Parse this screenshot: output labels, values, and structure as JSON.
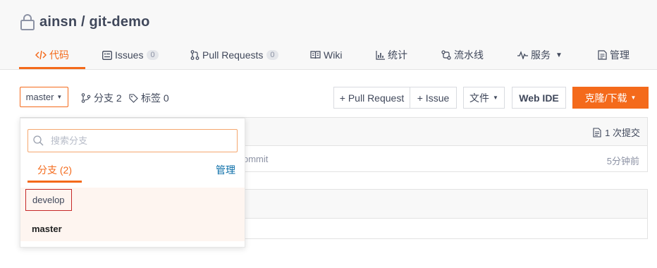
{
  "repo": {
    "title": "ainsn / git-demo",
    "icon": "lock-icon"
  },
  "tabs": [
    {
      "label": "代码",
      "icon": "code-icon",
      "active": true
    },
    {
      "label": "Issues",
      "count": "0",
      "icon": "issue-icon"
    },
    {
      "label": "Pull Requests",
      "count": "0",
      "icon": "pull-request-icon"
    },
    {
      "label": "Wiki",
      "icon": "book-icon"
    },
    {
      "label": "统计",
      "icon": "bar-chart-icon"
    },
    {
      "label": "流水线",
      "icon": "pipeline-icon"
    },
    {
      "label": "服务",
      "icon": "pulse-icon",
      "caret": "▼"
    },
    {
      "label": "管理",
      "icon": "document-icon"
    }
  ],
  "toolbar": {
    "branch": "master",
    "branches_label": "分支 2",
    "tags_label": "标签 0",
    "pull_request_btn": "+ Pull Request",
    "issue_btn": "+ Issue",
    "file_btn": "文件",
    "webide_btn": "Web IDE",
    "clone_btn": "克隆/下载"
  },
  "commits": {
    "count_label": "1 次提交",
    "message_fragment": "ommit",
    "time": "5分钟前"
  },
  "dropdown": {
    "search_placeholder": "搜索分支",
    "tab_label": "分支 (2)",
    "manage_label": "管理",
    "branches": [
      "develop",
      "master"
    ]
  },
  "colors": {
    "accent": "#f46a1b",
    "link": "#0b6ea8",
    "highlight_border": "#c62828"
  }
}
